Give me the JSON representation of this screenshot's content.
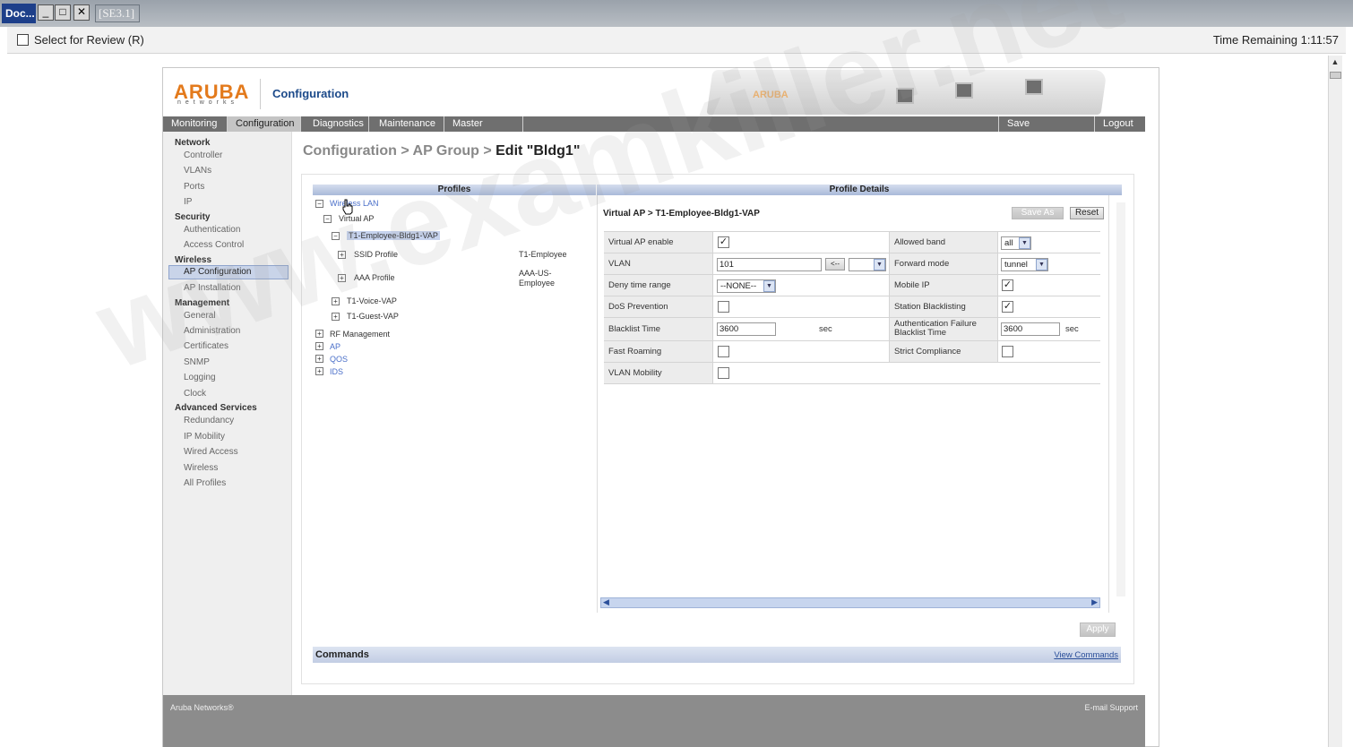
{
  "window": {
    "doc_tab": "Doc...",
    "sim_title": "[SE3.1]",
    "review_label": "Select for Review (R)",
    "time_remaining": "Time Remaining 1:11:57"
  },
  "header": {
    "logo": "ARUBA",
    "logo_sub": "networks",
    "title": "Configuration",
    "device_brand": "ARUBA"
  },
  "menu": {
    "items": [
      "Monitoring",
      "Configuration",
      "Diagnostics",
      "Maintenance",
      "Master Switch"
    ],
    "save": "Save Configuration",
    "logout": "Logout"
  },
  "sidebar": {
    "network": "Network",
    "controller": "Controller",
    "vlans": "VLANs",
    "ports": "Ports",
    "ip": "IP",
    "security": "Security",
    "authentication": "Authentication",
    "access_control": "Access Control",
    "wireless": "Wireless",
    "ap_configuration": "AP Configuration",
    "ap_installation": "AP Installation",
    "management": "Management",
    "general": "General",
    "administration": "Administration",
    "certificates": "Certificates",
    "snmp": "SNMP",
    "logging": "Logging",
    "clock": "Clock",
    "advanced": "Advanced Services",
    "redundancy": "Redundancy",
    "ip_mobility": "IP Mobility",
    "wired_access": "Wired Access",
    "wireless2": "Wireless",
    "all_profiles": "All Profiles"
  },
  "breadcrumb": {
    "path": "Configuration > AP Group > ",
    "current": "Edit \"Bldg1\""
  },
  "profiles": {
    "header": "Profiles",
    "wireless_lan": "Wireless LAN",
    "virtual_ap": "Virtual AP",
    "employee_vap": "T1-Employee-Bldg1-VAP",
    "ssid_profile": "SSID Profile",
    "ssid_value": "T1-Employee",
    "aaa_profile": "AAA Profile",
    "aaa_value": "AAA-US-Employee",
    "voice_vap": "T1-Voice-VAP",
    "guest_vap": "T1-Guest-VAP",
    "rf_management": "RF Management",
    "ap": "AP",
    "qos": "QOS",
    "ids": "IDS"
  },
  "details": {
    "header": "Profile Details",
    "vap_title": "Virtual AP > T1-Employee-Bldg1-VAP",
    "save_as": "Save As",
    "reset": "Reset",
    "virtual_ap_enable": "Virtual AP enable",
    "vlan": "VLAN",
    "vlan_value": "101",
    "vlan_arrow": "<--",
    "deny_time_range": "Deny time range",
    "deny_value": "--NONE--",
    "dos_prevention": "DoS Prevention",
    "blacklist_time": "Blacklist Time",
    "blacklist_value": "3600",
    "sec": "sec",
    "fast_roaming": "Fast Roaming",
    "vlan_mobility": "VLAN Mobility",
    "allowed_band": "Allowed band",
    "allowed_band_value": "all",
    "forward_mode": "Forward mode",
    "forward_mode_value": "tunnel",
    "mobile_ip": "Mobile IP",
    "station_blacklisting": "Station Blacklisting",
    "auth_failure": "Authentication Failure Blacklist Time",
    "auth_failure_value": "3600",
    "strict_compliance": "Strict Compliance",
    "check_mark": "✓"
  },
  "apply": "Apply",
  "commands": {
    "label": "Commands",
    "view": "View Commands"
  },
  "footer": {
    "left": "Aruba Networks®",
    "right": "E-mail Support"
  },
  "watermark": "www.examkiller.net"
}
